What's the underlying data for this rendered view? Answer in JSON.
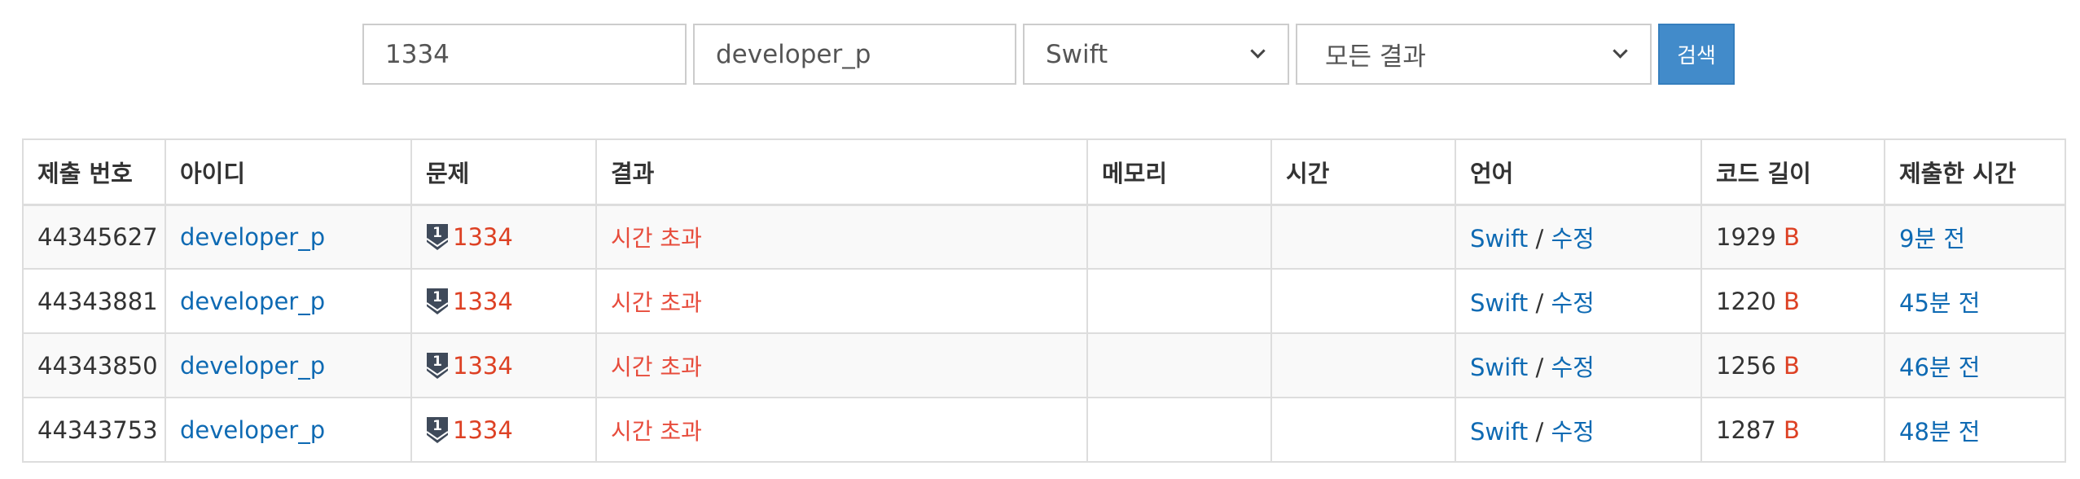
{
  "search": {
    "problem_value": "1334",
    "user_value": "developer_p",
    "language_selected": "Swift",
    "result_selected": "모든 결과",
    "button_label": "검색"
  },
  "table": {
    "headers": [
      "제출 번호",
      "아이디",
      "문제",
      "결과",
      "메모리",
      "시간",
      "언어",
      "코드 길이",
      "제출한 시간"
    ],
    "rows": [
      {
        "id": "44345627",
        "user": "developer_p",
        "tier": "1",
        "problem": "1334",
        "result": "시간 초과",
        "memory": "",
        "time": "",
        "language": "Swift",
        "sep": "/",
        "edit": "수정",
        "length": "1929",
        "unit": "B",
        "submitted": "9분 전"
      },
      {
        "id": "44343881",
        "user": "developer_p",
        "tier": "1",
        "problem": "1334",
        "result": "시간 초과",
        "memory": "",
        "time": "",
        "language": "Swift",
        "sep": "/",
        "edit": "수정",
        "length": "1220",
        "unit": "B",
        "submitted": "45분 전"
      },
      {
        "id": "44343850",
        "user": "developer_p",
        "tier": "1",
        "problem": "1334",
        "result": "시간 초과",
        "memory": "",
        "time": "",
        "language": "Swift",
        "sep": "/",
        "edit": "수정",
        "length": "1256",
        "unit": "B",
        "submitted": "46분 전"
      },
      {
        "id": "44343753",
        "user": "developer_p",
        "tier": "1",
        "problem": "1334",
        "result": "시간 초과",
        "memory": "",
        "time": "",
        "language": "Swift",
        "sep": "/",
        "edit": "수정",
        "length": "1287",
        "unit": "B",
        "submitted": "48분 전"
      }
    ]
  },
  "icons": {
    "tier": "tier-badge-icon",
    "dropdown": "chevron-down-icon"
  },
  "colors": {
    "link": "#0e6ab3",
    "result_fail": "#e74c3c",
    "problem": "#dd4124",
    "button": "#428bca",
    "tier_badge": "#3f4a5a",
    "row_stripe": "#f9f9f9",
    "border": "#dddddd"
  }
}
